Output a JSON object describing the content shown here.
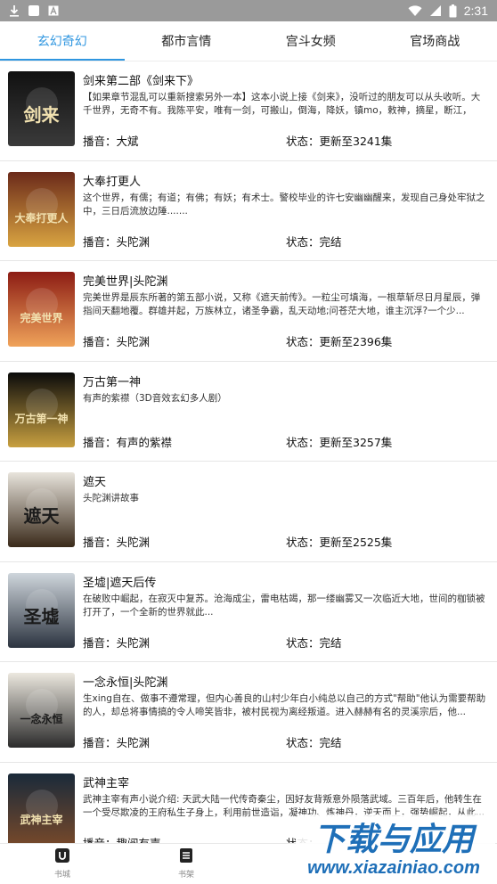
{
  "status_bar": {
    "time": "2:31",
    "icons": [
      "download-icon",
      "square-icon",
      "a-box-icon",
      "wifi-icon",
      "signal-icon",
      "battery-icon"
    ]
  },
  "tabs": [
    {
      "label": "玄幻奇幻",
      "active": true
    },
    {
      "label": "都市言情",
      "active": false
    },
    {
      "label": "宫斗女频",
      "active": false
    },
    {
      "label": "官场商战",
      "active": false
    }
  ],
  "colors": {
    "accent": "#2f96e0",
    "status_bar": "#9a9a9a"
  },
  "books": [
    {
      "title": "剑来第二部《剑来下》",
      "desc": "【如果章节混乱可以重新搜索另外一本】这本小说上接《剑来》，没听过的朋友可以从头收听。大千世界，无奇不有。我陈平安，唯有一剑，可搬山，倒海，降妖，镇mo，敕神，摘星，断江，摧...",
      "narrator": "播音：大斌",
      "status": "状态：更新至3241集",
      "cover_text": "剑来",
      "cover_colors": [
        "#111111",
        "#3a3a3a"
      ]
    },
    {
      "title": "大奉打更人",
      "desc": "这个世界，有儒；有道；有佛；有妖；有术士。警校毕业的许七安幽幽醒来，发现自己身处牢狱之中，三日后流放边陲.......",
      "narrator": "播音：头陀渊",
      "status": "状态：完结",
      "cover_text": "大奉打更人",
      "cover_colors": [
        "#6b2a1a",
        "#d9a441"
      ]
    },
    {
      "title": "完美世界|头陀渊",
      "desc": "完美世界是辰东所著的第五部小说，又称《遮天前传》。一粒尘可填海，一根草斩尽日月星辰，弹指间天翻地覆。群雄并起，万族林立，诸圣争霸，乱天动地;问苍茫大地，谁主沉浮?一个少...",
      "narrator": "播音：头陀渊",
      "status": "状态：更新至2396集",
      "cover_text": "完美世界",
      "cover_colors": [
        "#8c1c14",
        "#f0a35a"
      ]
    },
    {
      "title": "万古第一神",
      "desc": "有声的紫襟（3D音效玄幻多人剧）",
      "narrator": "播音：有声的紫襟",
      "status": "状态：更新至3257集",
      "cover_text": "万古第一神",
      "cover_colors": [
        "#0b0b0b",
        "#c8a040"
      ]
    },
    {
      "title": "遮天",
      "desc": "头陀渊讲故事",
      "narrator": "播音：头陀渊",
      "status": "状态：更新至2525集",
      "cover_text": "遮天",
      "cover_colors": [
        "#e8e4dc",
        "#3a2a1a"
      ]
    },
    {
      "title": "圣墟|遮天后传",
      "desc": "在破败中崛起，在寂灭中复苏。沧海成尘，雷电枯竭，那一缕幽雾又一次临近大地，世间的枷锁被打开了，一个全新的世界就此...",
      "narrator": "播音：头陀渊",
      "status": "状态：完结",
      "cover_text": "圣墟",
      "cover_colors": [
        "#cfd6dc",
        "#2c3440"
      ]
    },
    {
      "title": "一念永恒|头陀渊",
      "desc": "生xing自在、做事不遵常理，但内心善良的山村少年白小纯总以自己的方式\"帮助\"他认为需要帮助的人，却总将事情搞的令人啼笑皆非，被村民视为离经叛道。进入赫赫有名的灵溪宗后，他...",
      "narrator": "播音：头陀渊",
      "status": "状态：完结",
      "cover_text": "一念永恒",
      "cover_colors": [
        "#ece8df",
        "#2b2b2b"
      ]
    },
    {
      "title": "武神主宰",
      "desc": "武神主宰有声小说介绍: 天武大陆一代传奇秦尘，因好友背叛意外陨落武域。三百年后，他转生在一个受尽欺凌的王府私生子身上，利用前世造诣，凝神功、炼神丹，逆天而上，强势崛起，从此...",
      "narrator": "播音：趣阅有声",
      "status": "状态：",
      "cover_text": "武神主宰",
      "cover_colors": [
        "#1a2a3a",
        "#7a4a2a"
      ]
    }
  ],
  "bottom_nav": [
    {
      "label": "书城",
      "icon": "bookstore-icon"
    },
    {
      "label": "书架",
      "icon": "bookshelf-icon"
    }
  ],
  "watermark": {
    "title": "下载与应用",
    "url": "www.xiazainiao.com"
  }
}
